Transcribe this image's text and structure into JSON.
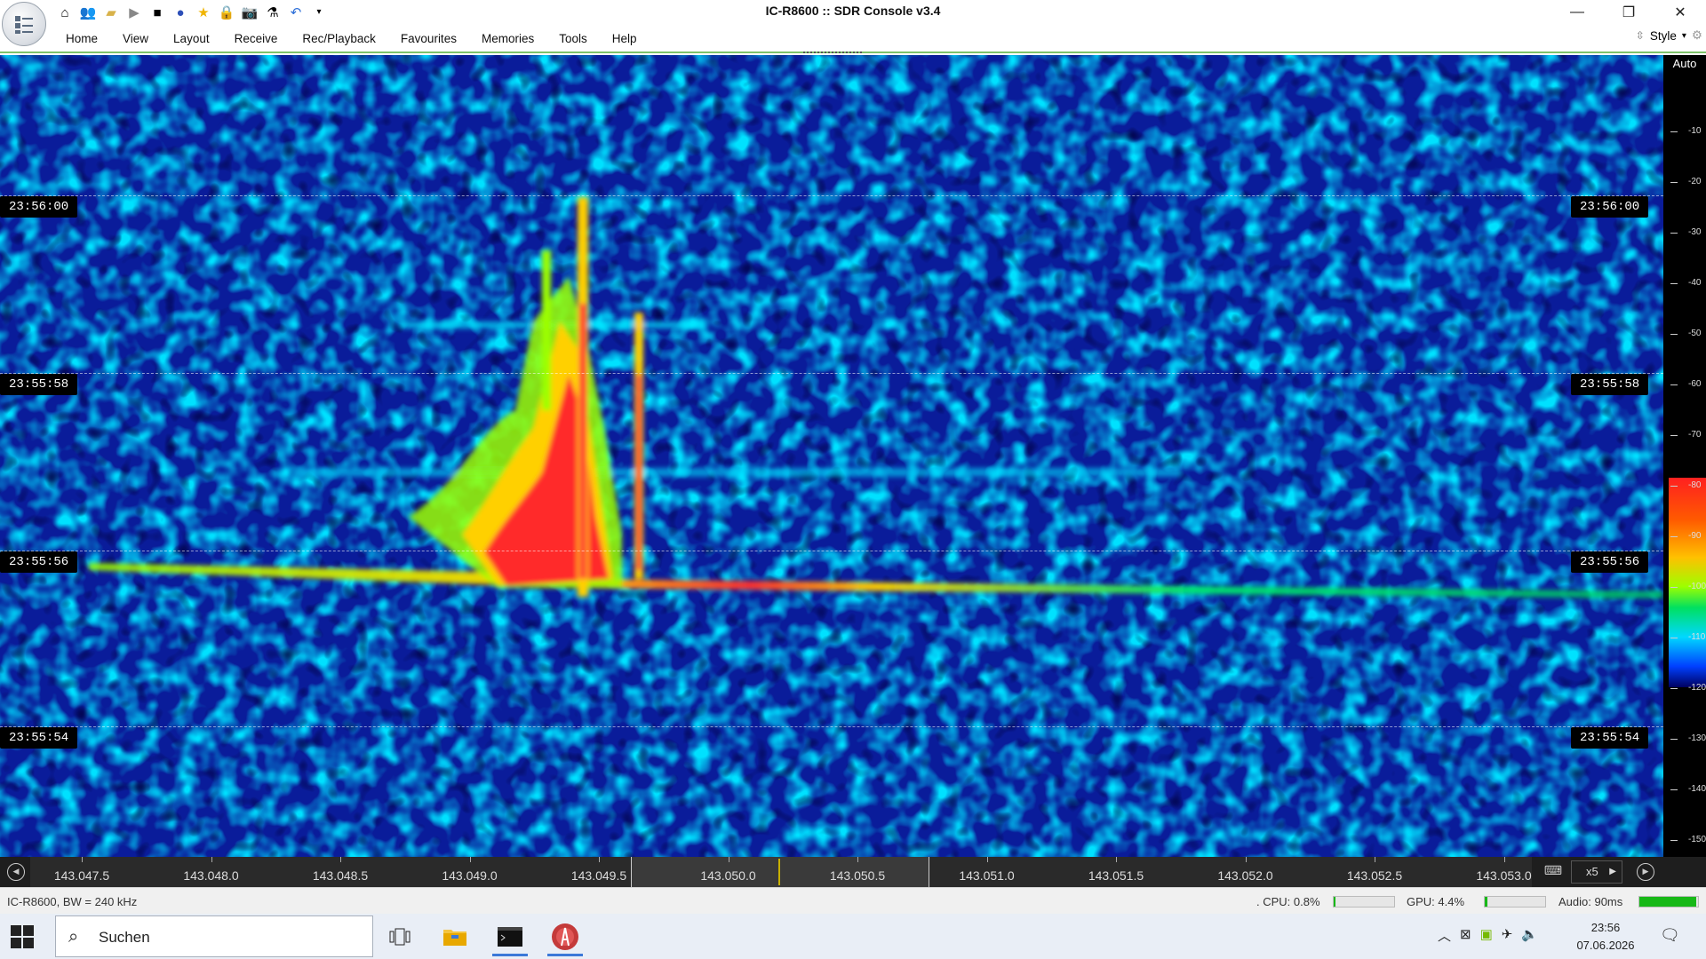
{
  "window": {
    "title": "IC-R8600 :: SDR Console v3.4",
    "controls": [
      "minimize-icon",
      "restore-icon",
      "close-icon"
    ]
  },
  "quick_access": [
    "home-icon",
    "users-icon",
    "folder-icon",
    "play-icon",
    "stop-icon",
    "record-icon",
    "star-icon",
    "lock-icon",
    "camera-icon",
    "flask-icon",
    "undo-icon",
    "dropdown-icon"
  ],
  "menu": {
    "tabs": [
      "Home",
      "View",
      "Layout",
      "Receive",
      "Rec/Playback",
      "Favourites",
      "Memories",
      "Tools",
      "Help"
    ],
    "style_label": "Style"
  },
  "waterfall": {
    "timestamps": [
      "23:56:00",
      "23:55:58",
      "23:55:56",
      "23:55:54"
    ],
    "colors": {
      "background": "#0a1c9a",
      "noise": "#00c8ff",
      "signal_low": "#9cff00",
      "signal_mid": "#ffd000",
      "signal_high": "#ff2020"
    }
  },
  "dbscale": {
    "mode": "Auto",
    "ticks": [
      "-10",
      "-20",
      "-30",
      "-40",
      "-50",
      "-60",
      "-70",
      "-80",
      "-90",
      "-100",
      "-110",
      "-120",
      "-130",
      "-140",
      "-150"
    ]
  },
  "frequency_axis": {
    "labels": [
      "143.047.5",
      "143.048.0",
      "143.048.5",
      "143.049.0",
      "143.049.5",
      "143.050.0",
      "143.050.5",
      "143.051.0",
      "143.051.5",
      "143.052.0",
      "143.052.5",
      "143.053.0"
    ],
    "zoom": "x5"
  },
  "statusbar": {
    "device": "IC-R8600, BW = 240 kHz",
    "cpu": ". CPU: 0.8%",
    "cpu_level": 0.008,
    "gpu": "GPU: 4.4%",
    "gpu_level": 0.044,
    "audio": "Audio: 90ms",
    "audio_level": 1.0
  },
  "taskbar": {
    "search_placeholder": "Suchen",
    "apps": [
      "task-view-icon",
      "file-explorer-icon",
      "terminal-icon",
      "sdr-console-icon"
    ],
    "time": "23:56",
    "date": "07.06.2026"
  }
}
